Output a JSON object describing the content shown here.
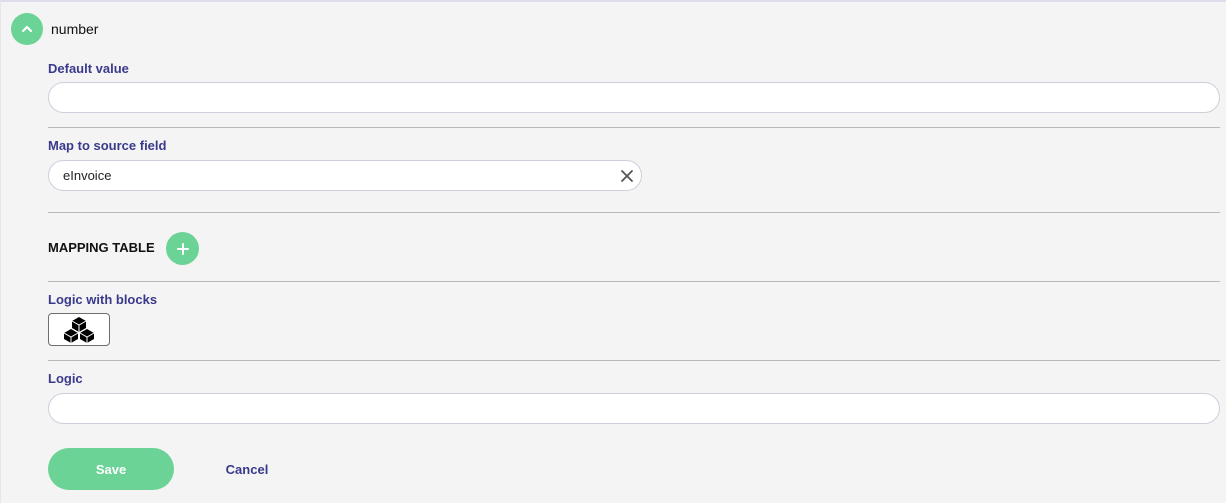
{
  "field": {
    "name": "number",
    "collapse_icon": "chevron-up-icon"
  },
  "default_value": {
    "label": "Default value",
    "value": ""
  },
  "map_source": {
    "label": "Map to source field",
    "value": "eInvoice",
    "clear_icon": "close-icon"
  },
  "mapping_table": {
    "title": "MAPPING TABLE",
    "add_icon": "plus-icon"
  },
  "logic_blocks": {
    "label": "Logic with blocks",
    "icon": "cubes-icon"
  },
  "logic": {
    "label": "Logic",
    "value": ""
  },
  "actions": {
    "save_label": "Save",
    "cancel_label": "Cancel"
  },
  "colors": {
    "accent": "#6bd396",
    "label": "#3a3a8c",
    "background": "#f4f4f4"
  }
}
